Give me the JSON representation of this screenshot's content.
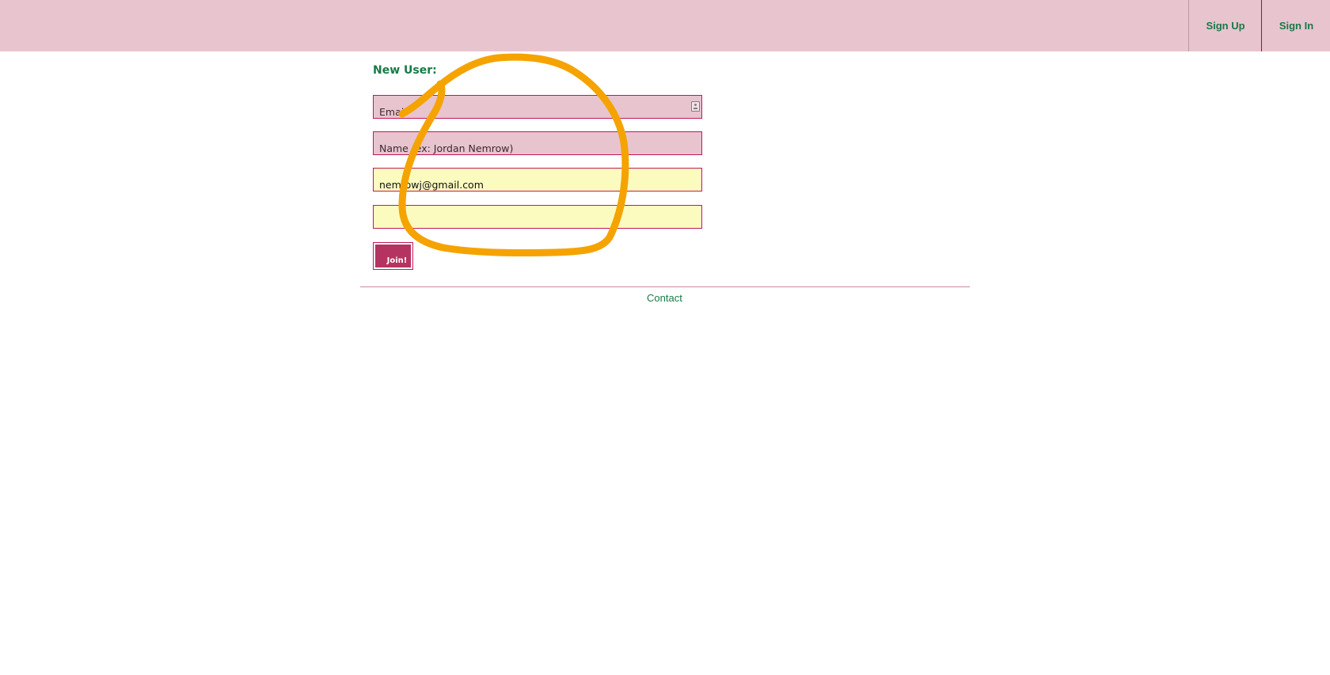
{
  "header": {
    "nav": {
      "sign_up": "Sign Up",
      "sign_in": "Sign In"
    }
  },
  "form": {
    "title": "New User:",
    "fields": [
      {
        "placeholder": "Email",
        "value": "",
        "icon": "contact-card-icon"
      },
      {
        "placeholder": "Name (ex: Jordan Nemrow)",
        "value": ""
      },
      {
        "placeholder": "",
        "value": "nemrowj@gmail.com"
      },
      {
        "placeholder": "",
        "value": ""
      }
    ],
    "submit_label": "Join!"
  },
  "footer": {
    "contact_label": "Contact"
  },
  "colors": {
    "header_bg": "#e8c4cf",
    "link_green": "#177a48",
    "field_border": "#c2185b",
    "autofill_yellow": "#fbfbbf",
    "button_bg": "#b5345f",
    "annotation_orange": "#f5a300"
  }
}
